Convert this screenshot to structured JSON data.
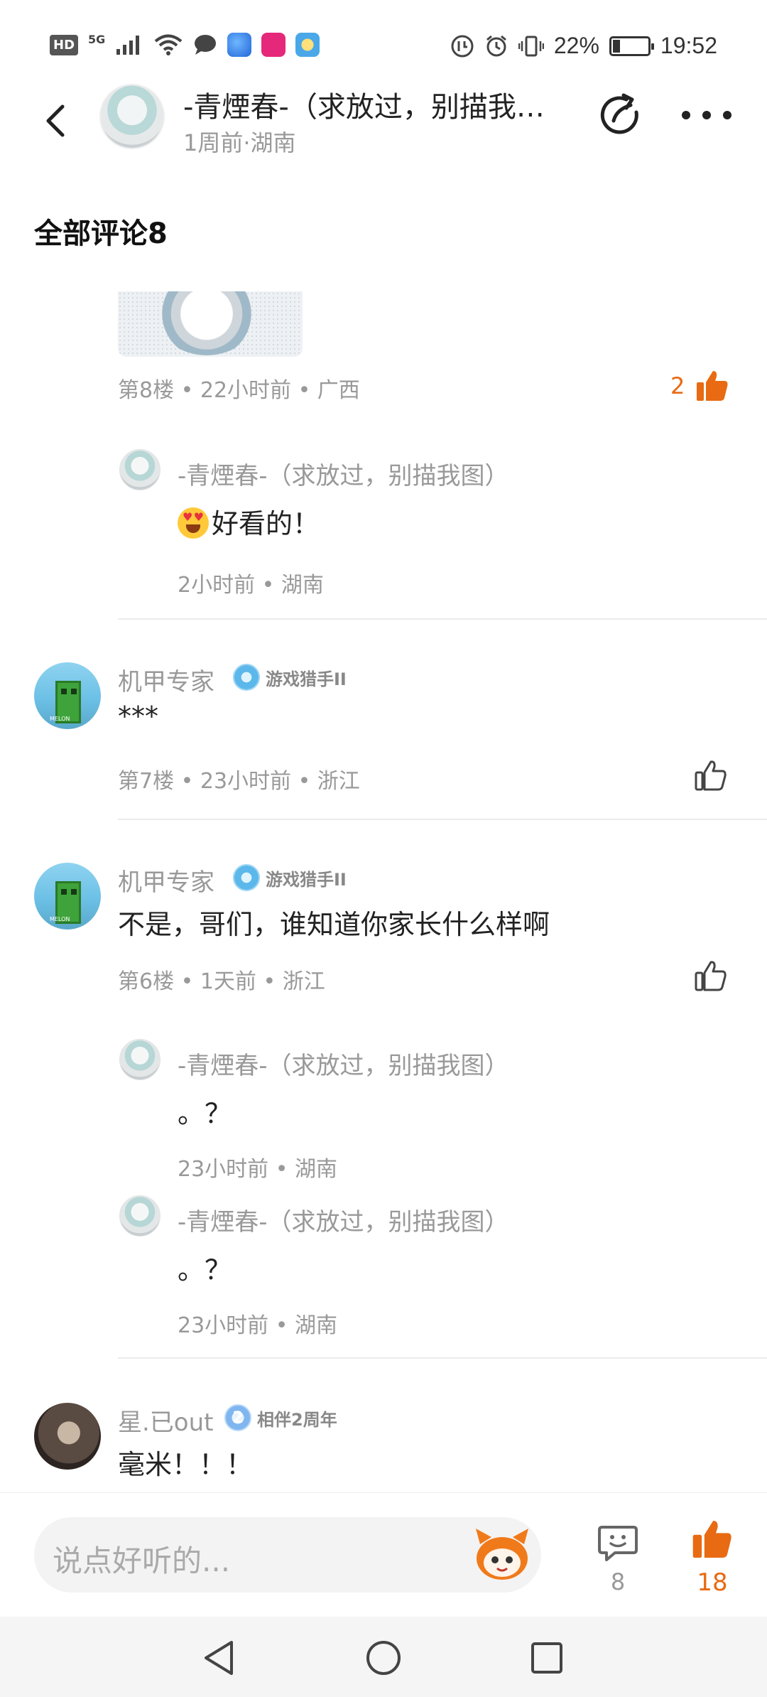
{
  "status_bar": {
    "hd": "HD",
    "network": "5G",
    "battery": "22%",
    "time": "19:52"
  },
  "header": {
    "title": "-青煙春-（求放过，别描我…",
    "subtitle": "1周前·湖南"
  },
  "section": {
    "title": "全部评论8"
  },
  "comments": [
    {
      "meta": "第8楼 • 22小时前 • 广西",
      "likes": "2",
      "replies": [
        {
          "name": "-青煙春-（求放过，别描我图）",
          "text": "好看的！",
          "meta": "2小时前 • 湖南"
        }
      ]
    },
    {
      "name": "机甲专家",
      "badge": "游戏猎手II",
      "text": "***",
      "meta": "第7楼 • 23小时前 • 浙江"
    },
    {
      "name": "机甲专家",
      "badge": "游戏猎手II",
      "text": "不是，哥们，谁知道你家长什么样啊",
      "meta": "第6楼 • 1天前 • 浙江",
      "replies": [
        {
          "name": "-青煙春-（求放过，别描我图）",
          "text": "。？",
          "meta": "23小时前 • 湖南"
        },
        {
          "name": "-青煙春-（求放过，别描我图）",
          "text": "。？",
          "meta": "23小时前 • 湖南"
        }
      ]
    },
    {
      "name": "星.已out",
      "badge": "相伴2周年",
      "badge_num": "2",
      "text": "毫米！！！"
    }
  ],
  "bottom_bar": {
    "input_placeholder": "说点好听的...",
    "comment_count": "8",
    "like_count": "18"
  },
  "colors": {
    "accent": "#e86a12",
    "secondary_text": "#999999",
    "input_bg": "#f3f3f3"
  }
}
